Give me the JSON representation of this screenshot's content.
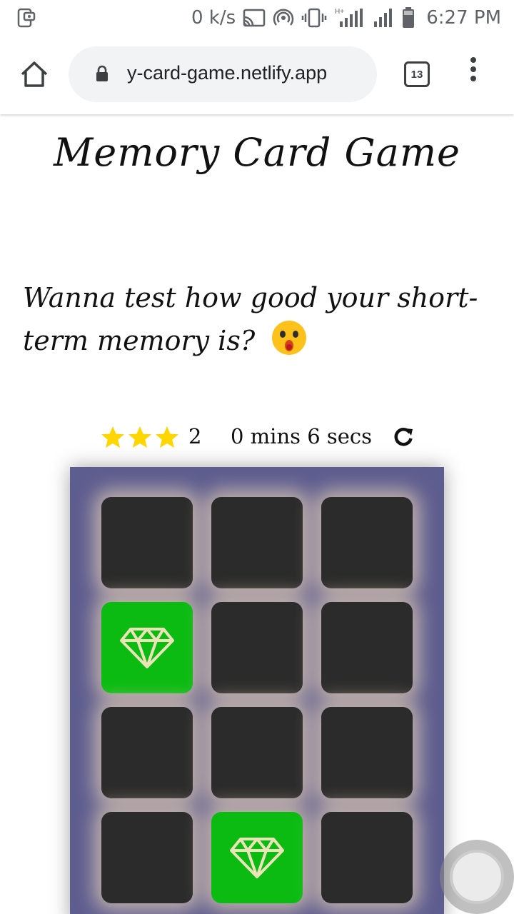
{
  "status_bar": {
    "speed": "0 k/s",
    "time": "6:27 PM",
    "icons": [
      "screenshot-icon",
      "cast-icon",
      "hotspot-icon",
      "vibrate-icon",
      "signal-icon",
      "signal-icon",
      "battery-icon"
    ],
    "network_label": "H+"
  },
  "browser": {
    "url": "y-card-game.netlify.app",
    "tab_count": "13"
  },
  "page": {
    "title": "Memory Card Game",
    "intro": "Wanna test how good your short-term memory is?",
    "score": {
      "stars": 3,
      "moves": "2",
      "timer": "0 mins 6 secs"
    }
  },
  "deck": {
    "cards": [
      {
        "state": "closed",
        "icon": ""
      },
      {
        "state": "closed",
        "icon": ""
      },
      {
        "state": "closed",
        "icon": ""
      },
      {
        "state": "match",
        "icon": "diamond-icon"
      },
      {
        "state": "closed",
        "icon": ""
      },
      {
        "state": "closed",
        "icon": ""
      },
      {
        "state": "closed",
        "icon": ""
      },
      {
        "state": "closed",
        "icon": ""
      },
      {
        "state": "closed",
        "icon": ""
      },
      {
        "state": "closed",
        "icon": ""
      },
      {
        "state": "match",
        "icon": "diamond-icon"
      },
      {
        "state": "closed",
        "icon": ""
      }
    ]
  },
  "colors": {
    "deck": "#5e5d8f",
    "card_closed": "#2b2b2b",
    "card_match": "#0bbb12",
    "star": "#ffd600"
  }
}
